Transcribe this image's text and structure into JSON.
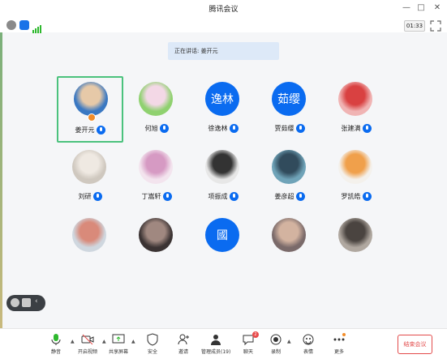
{
  "window": {
    "title": "腾讯会议",
    "min": "—",
    "max": "□",
    "close": "✕"
  },
  "infobar": {
    "timer": "01:33"
  },
  "speaking_label": "正在讲话: 姜开元",
  "participants": [
    {
      "name": "姜开元",
      "avatar": "photo",
      "avatar_text": "",
      "active": true,
      "host": true
    },
    {
      "name": "何旭",
      "avatar": "anime",
      "avatar_text": "",
      "active": false
    },
    {
      "name": "徐逸林",
      "avatar": "text",
      "avatar_text": "逸林",
      "active": false
    },
    {
      "name": "贾茹缨",
      "avatar": "text",
      "avatar_text": "茹缨",
      "active": false
    },
    {
      "name": "张建满",
      "avatar": "cartoon",
      "avatar_text": "",
      "active": false
    },
    {
      "name": "刘研",
      "avatar": "anime2",
      "avatar_text": "",
      "active": false
    },
    {
      "name": "丁嵩轩",
      "avatar": "anime3",
      "avatar_text": "",
      "active": false
    },
    {
      "name": "项振成",
      "avatar": "photo2",
      "avatar_text": "",
      "active": false
    },
    {
      "name": "姜彦超",
      "avatar": "art",
      "avatar_text": "",
      "active": false
    },
    {
      "name": "罗凯皓",
      "avatar": "charmander",
      "avatar_text": "",
      "active": false
    },
    {
      "name": "",
      "avatar": "art2",
      "avatar_text": "",
      "active": false
    },
    {
      "name": "",
      "avatar": "photo3",
      "avatar_text": "",
      "active": false
    },
    {
      "name": "",
      "avatar": "text",
      "avatar_text": "國",
      "active": false
    },
    {
      "name": "",
      "avatar": "photo4",
      "avatar_text": "",
      "active": false
    },
    {
      "name": "",
      "avatar": "photo5",
      "avatar_text": "",
      "active": false
    }
  ],
  "toolbar": {
    "mute": "静音",
    "video": "开启视频",
    "share": "共享屏幕",
    "security": "安全",
    "invite": "邀请",
    "members": "管理成员(19)",
    "chat": "聊天",
    "chat_badge": "2",
    "record": "录制",
    "reaction": "表情",
    "more": "更多",
    "end": "结束会议"
  },
  "colors": {
    "accent": "#0a6bf0",
    "active_border": "#4bc27d",
    "end": "#e34b4b"
  }
}
